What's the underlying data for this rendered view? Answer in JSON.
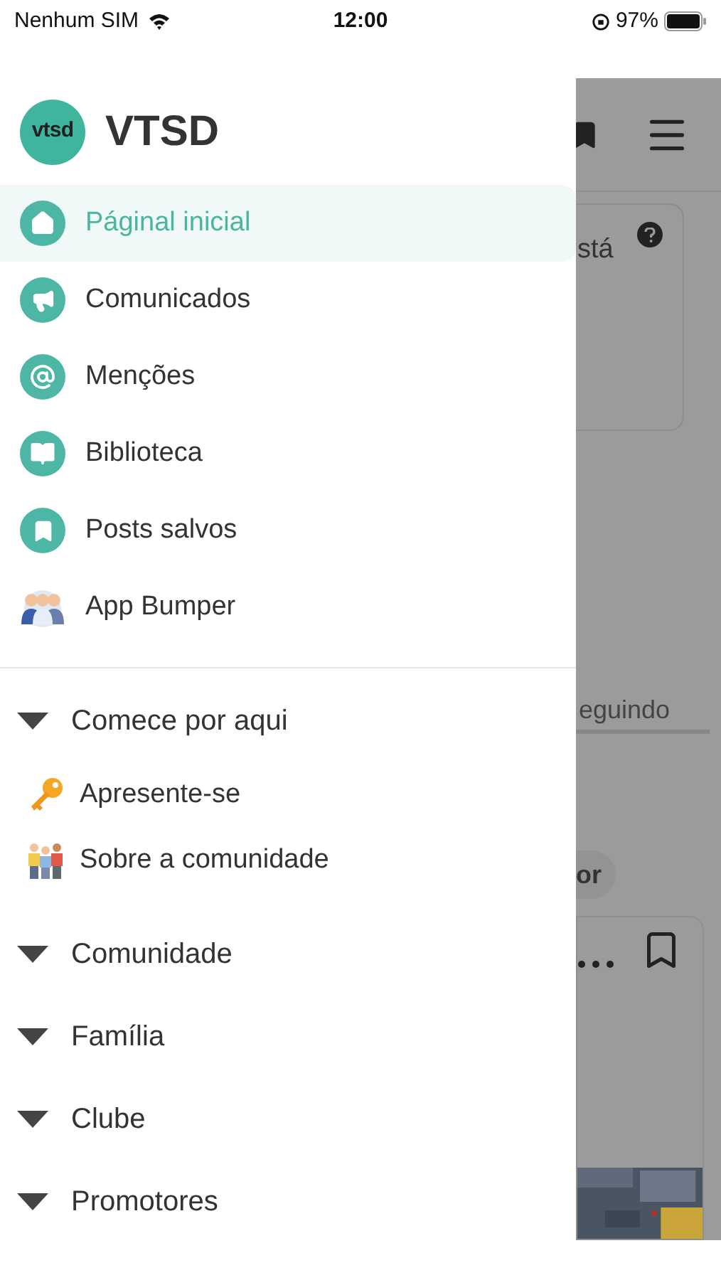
{
  "status_bar": {
    "carrier": "Nenhum SIM",
    "time": "12:00",
    "battery": "97%"
  },
  "drawer": {
    "logo_text": "vtsd",
    "title": "VTSD",
    "items": [
      {
        "kind": "home",
        "label": "Páginal inicial",
        "selected": true
      },
      {
        "kind": "megaphone",
        "label": "Comunicados",
        "selected": false
      },
      {
        "kind": "at",
        "label": "Menções",
        "selected": false
      },
      {
        "kind": "book",
        "label": "Biblioteca",
        "selected": false
      },
      {
        "kind": "bookmark",
        "label": "Posts salvos",
        "selected": false
      },
      {
        "kind": "group",
        "label": "App Bumper",
        "selected": false
      }
    ],
    "sections": [
      {
        "label": "Comece por aqui",
        "children": [
          {
            "kind": "key",
            "label": "Apresente-se"
          },
          {
            "kind": "people",
            "label": "Sobre a comunidade"
          }
        ]
      },
      {
        "label": "Comunidade"
      },
      {
        "label": "Família"
      },
      {
        "label": "Clube"
      },
      {
        "label": "Promotores"
      }
    ]
  },
  "background": {
    "card_text": "stá",
    "tab": "eguindo",
    "chip": "or"
  }
}
